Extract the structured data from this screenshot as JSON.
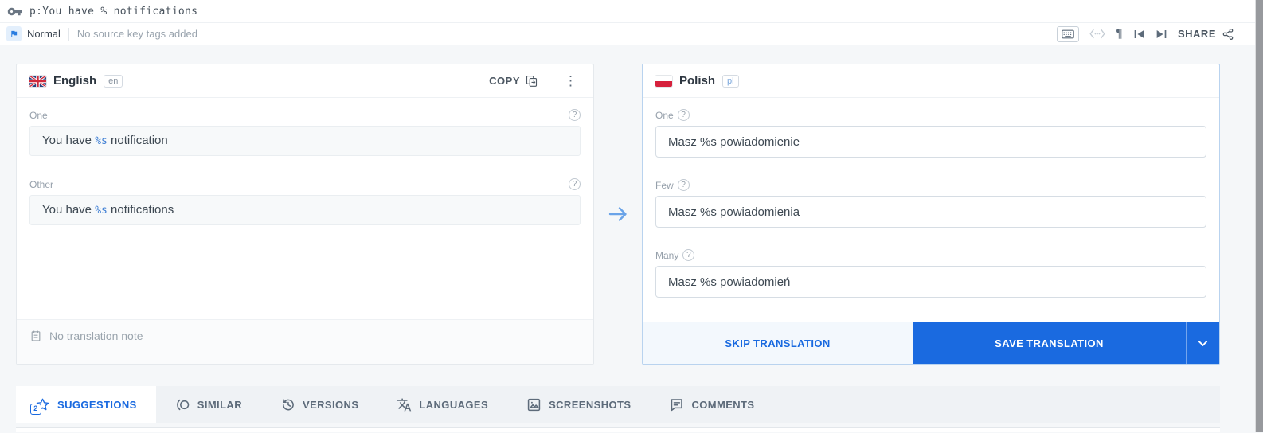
{
  "header": {
    "key_name": "p:You have % notifications"
  },
  "toolbar": {
    "status_label": "Normal",
    "tags_placeholder": "No source key tags added",
    "share_label": "SHARE",
    "icon_names": [
      "keyboard-icon",
      "code-icon",
      "pilcrow-icon",
      "previous-key-icon",
      "next-key-icon",
      "share-icon"
    ]
  },
  "icons": {
    "help_glyph": "?",
    "pilcrow_glyph": "¶",
    "kebab_glyph": "⋮"
  },
  "source_panel": {
    "language_name": "English",
    "language_code": "en",
    "copy_label": "COPY",
    "plural_fields": [
      {
        "label": "One",
        "text_before": "You have ",
        "token": "%s",
        "text_after": " notification"
      },
      {
        "label": "Other",
        "text_before": "You have ",
        "token": "%s",
        "text_after": " notifications"
      }
    ],
    "note_placeholder": "No translation note"
  },
  "target_panel": {
    "language_name": "Polish",
    "language_code": "pl",
    "plural_fields": [
      {
        "label": "One",
        "value": "Masz %s powiadomienie"
      },
      {
        "label": "Few",
        "value": "Masz %s powiadomienia"
      },
      {
        "label": "Many",
        "value": "Masz %s powiadomień"
      }
    ],
    "skip_button": "SKIP TRANSLATION",
    "save_button": "SAVE TRANSLATION"
  },
  "tabs": [
    {
      "label": "SUGGESTIONS",
      "badge": "2",
      "icon": "star-icon",
      "active": true
    },
    {
      "label": "SIMILAR",
      "icon": "similar-icon",
      "active": false
    },
    {
      "label": "VERSIONS",
      "icon": "history-icon",
      "active": false
    },
    {
      "label": "LANGUAGES",
      "icon": "translate-icon",
      "active": false
    },
    {
      "label": "SCREENSHOTS",
      "icon": "image-icon",
      "active": false
    },
    {
      "label": "COMMENTS",
      "icon": "comment-icon",
      "active": false
    }
  ],
  "colors": {
    "accent_blue": "#1a6ae0",
    "token_blue": "#3f7fd4",
    "skip_button_bg": "#f3f8fd",
    "active_panel_border": "#b9d3ef",
    "page_background": "#f5f7f9",
    "scrollbar": "#97999d"
  }
}
